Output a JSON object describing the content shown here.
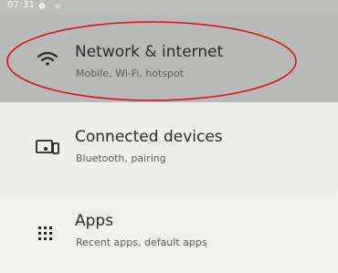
{
  "status_bar": {
    "time": "07:31",
    "icons": [
      "settings-gear-icon",
      "wifi-status-icon"
    ]
  },
  "settings_list": [
    {
      "title": "Network & internet",
      "subtitle": "Mobile, Wi-Fi, hotspot",
      "icon": "wifi-icon"
    },
    {
      "title": "Connected devices",
      "subtitle": "Bluetooth, pairing",
      "icon": "connected-devices-icon"
    },
    {
      "title": "Apps",
      "subtitle": "Recent apps, default apps",
      "icon": "apps-grid-icon"
    }
  ],
  "annotation": {
    "shape": "ellipse",
    "color": "#d4151b",
    "target": "Network & internet"
  },
  "colors": {
    "selected_row_bg": "#b9b9b7",
    "title_text": "#2b2b2b",
    "subtitle_text": "#5a5a5a"
  }
}
